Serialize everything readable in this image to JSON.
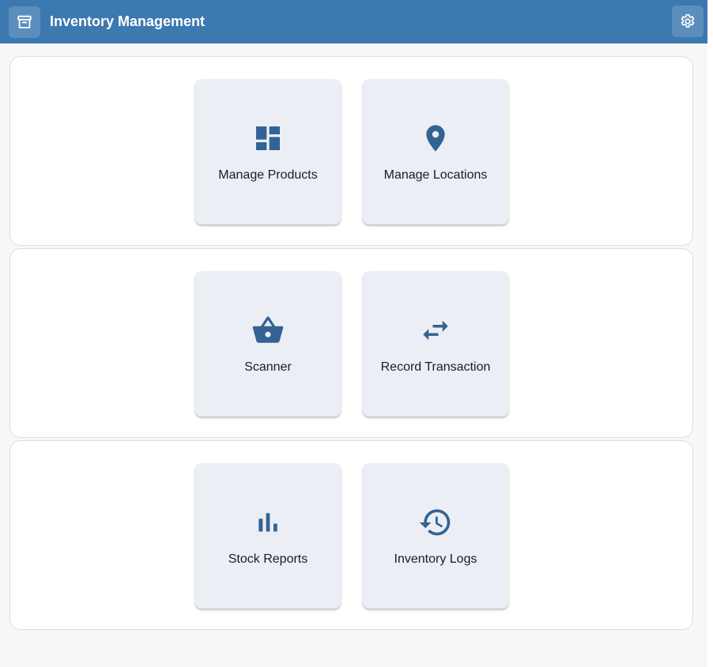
{
  "app": {
    "title": "Inventory Management",
    "left_icon": "archive-icon",
    "right_icon": "settings-gear-icon"
  },
  "colors": {
    "appbar": "#3c79b0",
    "icon": "#336394",
    "tile": "#eceef5",
    "page_bg": "#f6f7f9"
  },
  "tiles": [
    {
      "label": "Manage Products",
      "icon": "dashboard-icon"
    },
    {
      "label": "Manage Locations",
      "icon": "location-pin-icon"
    },
    {
      "label": "Scanner",
      "icon": "basket-icon"
    },
    {
      "label": "Record Transaction",
      "icon": "swap-arrows-icon"
    },
    {
      "label": "Stock Reports",
      "icon": "bar-chart-icon"
    },
    {
      "label": "Inventory Logs",
      "icon": "history-icon"
    }
  ]
}
